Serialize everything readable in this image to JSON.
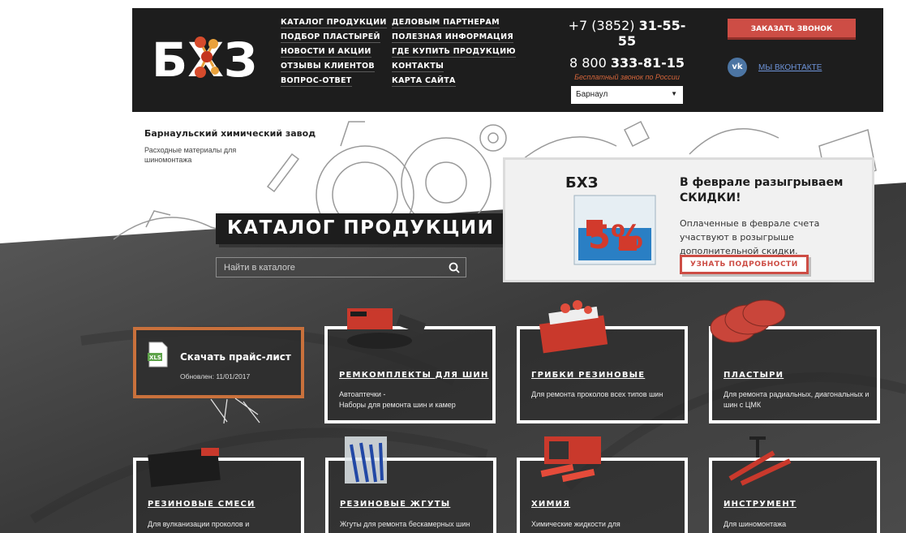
{
  "brand": {
    "logo_text": "БХЗ"
  },
  "nav": {
    "col1": [
      "КАТАЛОГ ПРОДУКЦИИ",
      "ПОДБОР ПЛАСТЫРЕЙ",
      "НОВОСТИ И АКЦИИ",
      "ОТЗЫВЫ КЛИЕНТОВ",
      "ВОПРОС-ОТВЕТ"
    ],
    "col2": [
      "ДЕЛОВЫМ ПАРТНЕРАМ",
      "ПОЛЕЗНАЯ ИНФОРМАЦИЯ",
      "ГДЕ КУПИТЬ ПРОДУКЦИЮ",
      "КОНТАКТЫ",
      "КАРТА САЙТА"
    ]
  },
  "contacts": {
    "phone1_prefix": "+7 (3852)",
    "phone1_main": "31-55-55",
    "phone2_prefix": "8 800",
    "phone2_main": "333-81-15",
    "free_call": "Бесплатный звонок по России",
    "city": "Барнаул"
  },
  "actions": {
    "order_call": "ЗАКАЗАТЬ ЗВОНОК",
    "vk_label": "МЫ ВКОНТАКТЕ"
  },
  "company": {
    "name": "Барнаульский химический завод",
    "tagline": "Расходные материалы для шиномонтажа"
  },
  "catalog": {
    "title": "КАТАЛОГ ПРОДУКЦИИ",
    "search_placeholder": "Найти в каталоге"
  },
  "promo": {
    "title": "В феврале разыгрываем СКИДКИ!",
    "text": "Оплаченные в феврале счета участвуют в розыгрыше дополнительной скидки.",
    "button": "УЗНАТЬ ПОДРОБНОСТИ",
    "badge": "5%"
  },
  "price_list": {
    "title": "Скачать прайс-лист",
    "updated": "Обновлен: 11/01/2017",
    "file_badge": "XLS"
  },
  "categories": [
    {
      "title": "РЕМКОМПЛЕКТЫ ДЛЯ ШИН",
      "desc": "Автоаптечки -\nНаборы для ремонта шин и камер"
    },
    {
      "title": "ГРИБКИ РЕЗИНОВЫЕ",
      "desc": "Для ремонта проколов всех типов шин"
    },
    {
      "title": "ПЛАСТЫРИ",
      "desc": "Для ремонта радиальных, диагональных и шин с ЦМК"
    },
    {
      "title": "РЕЗИНОВЫЕ СМЕСИ",
      "desc": "Для вулканизации проколов и"
    },
    {
      "title": "РЕЗИНОВЫЕ ЖГУТЫ",
      "desc": "Жгуты для ремонта бескамерных шин"
    },
    {
      "title": "ХИМИЯ",
      "desc": "Химические жидкости для"
    },
    {
      "title": "ИНСТРУМЕНТ",
      "desc": "Для шиномонтажа"
    }
  ],
  "colors": {
    "accent": "#cd4d45",
    "header_bg": "#1d1d1d",
    "orange": "#c9713c",
    "vk": "#4c75a3"
  }
}
